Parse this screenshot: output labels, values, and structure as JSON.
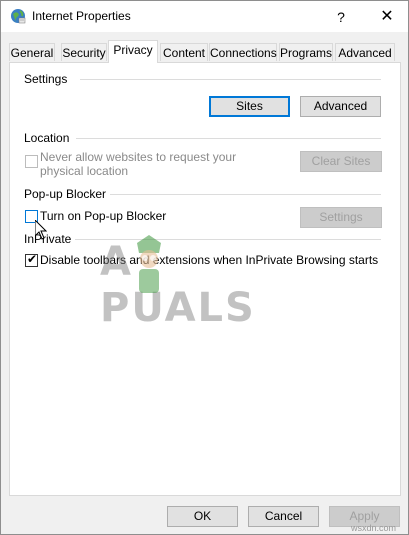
{
  "window": {
    "title": "Internet Properties",
    "help": "?",
    "close": "✕"
  },
  "tabs": [
    {
      "label": "General"
    },
    {
      "label": "Security"
    },
    {
      "label": "Privacy",
      "active": true
    },
    {
      "label": "Content"
    },
    {
      "label": "Connections"
    },
    {
      "label": "Programs"
    },
    {
      "label": "Advanced"
    }
  ],
  "settings": {
    "label": "Settings",
    "sites_button": "Sites",
    "advanced_button": "Advanced"
  },
  "location": {
    "label": "Location",
    "checkbox_label_line1": "Never allow websites to request your",
    "checkbox_label_line2": "physical location",
    "checked": false,
    "clear_sites_button": "Clear Sites"
  },
  "popup": {
    "label": "Pop-up Blocker",
    "checkbox_label": "Turn on Pop-up Blocker",
    "checked": false,
    "settings_button": "Settings"
  },
  "inprivate": {
    "label": "InPrivate",
    "checkbox_label": "Disable toolbars and extensions when InPrivate Browsing starts",
    "checked": true
  },
  "watermark": {
    "text": "A PUALS"
  },
  "footer": {
    "ok": "OK",
    "cancel": "Cancel",
    "apply": "Apply",
    "source": "wsxdn.com"
  }
}
